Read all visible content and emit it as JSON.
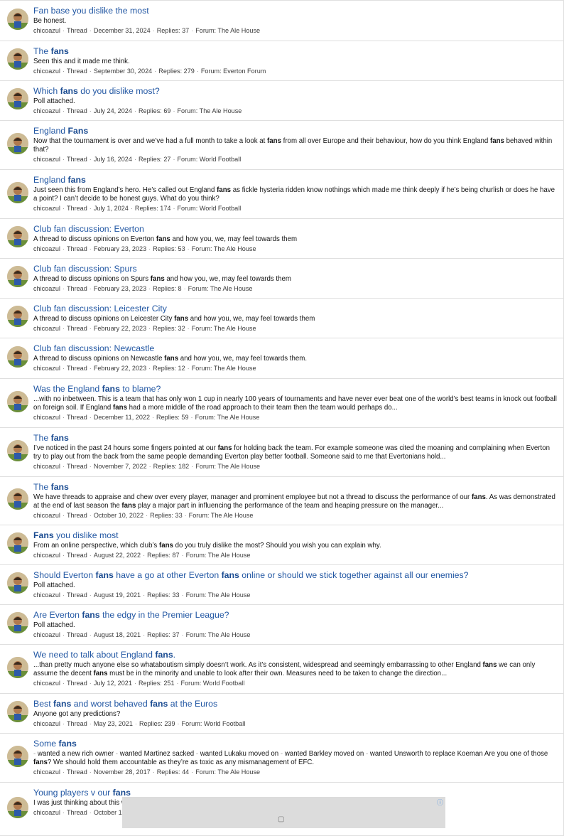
{
  "results": [
    {
      "title": [
        {
          "t": "Fan base you dislike the most"
        }
      ],
      "snippet": [
        {
          "t": "Be honest."
        }
      ],
      "author": "chicoazul",
      "type": "Thread",
      "date": "December 31, 2024",
      "replies": "Replies: 37",
      "forum": "Forum: The Ale House"
    },
    {
      "title": [
        {
          "t": "The "
        },
        {
          "t": "fans",
          "b": true
        }
      ],
      "snippet": [
        {
          "t": "Seen this and it made me think."
        }
      ],
      "author": "chicoazul",
      "type": "Thread",
      "date": "September 30, 2024",
      "replies": "Replies: 279",
      "forum": "Forum: Everton Forum"
    },
    {
      "title": [
        {
          "t": "Which "
        },
        {
          "t": "fans",
          "b": true
        },
        {
          "t": " do you dislike most?"
        }
      ],
      "snippet": [
        {
          "t": "Poll attached."
        }
      ],
      "author": "chicoazul",
      "type": "Thread",
      "date": "July 24, 2024",
      "replies": "Replies: 69",
      "forum": "Forum: The Ale House"
    },
    {
      "title": [
        {
          "t": "England "
        },
        {
          "t": "Fans",
          "b": true
        }
      ],
      "snippet": [
        {
          "t": "Now that the tournament is over and we’ve had a full month to take a look at "
        },
        {
          "t": "fans",
          "b": true
        },
        {
          "t": " from all over Europe and their behaviour, how do you think England "
        },
        {
          "t": "fans",
          "b": true
        },
        {
          "t": " behaved within that?"
        }
      ],
      "author": "chicoazul",
      "type": "Thread",
      "date": "July 16, 2024",
      "replies": "Replies: 27",
      "forum": "Forum: World Football"
    },
    {
      "title": [
        {
          "t": "England "
        },
        {
          "t": "fans",
          "b": true
        }
      ],
      "snippet": [
        {
          "t": "Just seen this from England’s hero. He’s called out England "
        },
        {
          "t": "fans",
          "b": true
        },
        {
          "t": " as fickle hysteria ridden know nothings which made me think deeply if he’s being churlish or does he have a point? I can’t decide to be honest guys. What do you think?"
        }
      ],
      "author": "chicoazul",
      "type": "Thread",
      "date": "July 1, 2024",
      "replies": "Replies: 174",
      "forum": "Forum: World Football"
    },
    {
      "title": [
        {
          "t": "Club fan discussion: Everton"
        }
      ],
      "snippet": [
        {
          "t": "A thread to discuss opinions on Everton "
        },
        {
          "t": "fans",
          "b": true
        },
        {
          "t": " and how you, we, may feel towards them"
        }
      ],
      "author": "chicoazul",
      "type": "Thread",
      "date": "February 23, 2023",
      "replies": "Replies: 53",
      "forum": "Forum: The Ale House"
    },
    {
      "title": [
        {
          "t": "Club fan discussion: Spurs"
        }
      ],
      "snippet": [
        {
          "t": "A thread to discuss opinions on Spurs "
        },
        {
          "t": "fans",
          "b": true
        },
        {
          "t": " and how you, we, may feel towards them"
        }
      ],
      "author": "chicoazul",
      "type": "Thread",
      "date": "February 23, 2023",
      "replies": "Replies: 8",
      "forum": "Forum: The Ale House"
    },
    {
      "title": [
        {
          "t": "Club fan discussion: Leicester City"
        }
      ],
      "snippet": [
        {
          "t": "A thread to discuss opinions on Leicester City "
        },
        {
          "t": "fans",
          "b": true
        },
        {
          "t": " and how you, we, may feel towards them"
        }
      ],
      "author": "chicoazul",
      "type": "Thread",
      "date": "February 22, 2023",
      "replies": "Replies: 32",
      "forum": "Forum: The Ale House"
    },
    {
      "title": [
        {
          "t": "Club fan discussion: Newcastle"
        }
      ],
      "snippet": [
        {
          "t": "A thread to discuss opinions on Newcastle "
        },
        {
          "t": "fans",
          "b": true
        },
        {
          "t": " and how you, we, may feel towards them."
        }
      ],
      "author": "chicoazul",
      "type": "Thread",
      "date": "February 22, 2023",
      "replies": "Replies: 12",
      "forum": "Forum: The Ale House"
    },
    {
      "title": [
        {
          "t": "Was the England "
        },
        {
          "t": "fans",
          "b": true
        },
        {
          "t": " to blame?"
        }
      ],
      "snippet": [
        {
          "t": "...with no inbetween. This is a team that has only won 1 cup in nearly 100 years of tournaments and have never ever beat one of the world’s best teams in knock out football on foreign soil. If England "
        },
        {
          "t": "fans",
          "b": true
        },
        {
          "t": " had a more middle of the road approach to their team then the team would perhaps do..."
        }
      ],
      "author": "chicoazul",
      "type": "Thread",
      "date": "December 11, 2022",
      "replies": "Replies: 59",
      "forum": "Forum: The Ale House"
    },
    {
      "title": [
        {
          "t": "The "
        },
        {
          "t": "fans",
          "b": true
        }
      ],
      "snippet": [
        {
          "t": "I’ve noticed in the past 24 hours some fingers pointed at our "
        },
        {
          "t": "fans",
          "b": true
        },
        {
          "t": " for holding back the team. For example someone was cited the moaning and complaining when Everton try to play out from the back from the same people demanding Everton play better football. Someone said to me that Evertonians hold..."
        }
      ],
      "author": "chicoazul",
      "type": "Thread",
      "date": "November 7, 2022",
      "replies": "Replies: 182",
      "forum": "Forum: The Ale House"
    },
    {
      "title": [
        {
          "t": "The "
        },
        {
          "t": "fans",
          "b": true
        }
      ],
      "snippet": [
        {
          "t": "We have threads to appraise and chew over every player, manager and prominent employee but not a thread to discuss the performance of our "
        },
        {
          "t": "fans",
          "b": true
        },
        {
          "t": ". As was demonstrated at the end of last season the "
        },
        {
          "t": "fans",
          "b": true
        },
        {
          "t": " play a major part in influencing the performance of the team and heaping pressure on the manager..."
        }
      ],
      "author": "chicoazul",
      "type": "Thread",
      "date": "October 10, 2022",
      "replies": "Replies: 33",
      "forum": "Forum: The Ale House"
    },
    {
      "title": [
        {
          "t": "Fans",
          "b": true
        },
        {
          "t": " you dislike most"
        }
      ],
      "snippet": [
        {
          "t": "From an online perspective, which club’s "
        },
        {
          "t": "fans",
          "b": true
        },
        {
          "t": " do you truly dislike the most? Should you wish you can explain why."
        }
      ],
      "author": "chicoazul",
      "type": "Thread",
      "date": "August 22, 2022",
      "replies": "Replies: 87",
      "forum": "Forum: The Ale House"
    },
    {
      "title": [
        {
          "t": "Should Everton "
        },
        {
          "t": "fans",
          "b": true
        },
        {
          "t": " have a go at other Everton "
        },
        {
          "t": "fans",
          "b": true
        },
        {
          "t": " online or should we stick together against all our enemies?"
        }
      ],
      "snippet": [
        {
          "t": "Poll attached."
        }
      ],
      "author": "chicoazul",
      "type": "Thread",
      "date": "August 19, 2021",
      "replies": "Replies: 33",
      "forum": "Forum: The Ale House"
    },
    {
      "title": [
        {
          "t": "Are Everton "
        },
        {
          "t": "fans",
          "b": true
        },
        {
          "t": " the edgy in the Premier League?"
        }
      ],
      "snippet": [
        {
          "t": "Poll attached."
        }
      ],
      "author": "chicoazul",
      "type": "Thread",
      "date": "August 18, 2021",
      "replies": "Replies: 37",
      "forum": "Forum: The Ale House"
    },
    {
      "title": [
        {
          "t": "We need to talk about England "
        },
        {
          "t": "fans",
          "b": true
        },
        {
          "t": "."
        }
      ],
      "snippet": [
        {
          "t": "...than pretty much anyone else so whataboutism simply doesn’t work. As it’s consistent, widespread and seemingly embarrassing to other England "
        },
        {
          "t": "fans",
          "b": true
        },
        {
          "t": " we can only assume the decent "
        },
        {
          "t": "fans",
          "b": true
        },
        {
          "t": " must be in the minority and unable to look after their own. Measures need to be taken to change the direction..."
        }
      ],
      "author": "chicoazul",
      "type": "Thread",
      "date": "July 12, 2021",
      "replies": "Replies: 251",
      "forum": "Forum: World Football"
    },
    {
      "title": [
        {
          "t": "Best "
        },
        {
          "t": "fans",
          "b": true
        },
        {
          "t": " and worst behaved "
        },
        {
          "t": "fans",
          "b": true
        },
        {
          "t": " at the Euros"
        }
      ],
      "snippet": [
        {
          "t": "Anyone got any predictions?"
        }
      ],
      "author": "chicoazul",
      "type": "Thread",
      "date": "May 23, 2021",
      "replies": "Replies: 239",
      "forum": "Forum: World Football"
    },
    {
      "title": [
        {
          "t": "Some "
        },
        {
          "t": "fans",
          "b": true
        }
      ],
      "snippet": [
        {
          "t": "- ",
          "s": true
        },
        {
          "t": "wanted a new rich owner "
        },
        {
          "t": "- ",
          "s": true
        },
        {
          "t": "wanted Martinez sacked "
        },
        {
          "t": "- ",
          "s": true
        },
        {
          "t": "wanted Lukaku moved on "
        },
        {
          "t": "- ",
          "s": true
        },
        {
          "t": "wanted Barkley moved on "
        },
        {
          "t": "- ",
          "s": true
        },
        {
          "t": "wanted Unsworth to replace Koeman Are you one of those "
        },
        {
          "t": "fans",
          "b": true
        },
        {
          "t": "? We should hold them accountable as they’re as toxic as any mismanagement of EFC."
        }
      ],
      "author": "chicoazul",
      "type": "Thread",
      "date": "November 28, 2017",
      "replies": "Replies: 44",
      "forum": "Forum: The Ale House"
    },
    {
      "title": [
        {
          "t": "Young players v our "
        },
        {
          "t": "fans",
          "b": true
        }
      ],
      "snippet": [
        {
          "t": "I was just thinking about this when you think of Lukaku, Stones and Barkley they were..."
        }
      ],
      "author": "chicoazul",
      "type": "Thread",
      "date": "October 16",
      "replies": "",
      "forum": ""
    }
  ],
  "ad": {
    "info_glyph": "ⓘ",
    "icon_glyph": "▢"
  },
  "colors": {
    "link": "#2257a3",
    "border": "#dfdfdf",
    "ad_bg": "#dcdcdc"
  }
}
